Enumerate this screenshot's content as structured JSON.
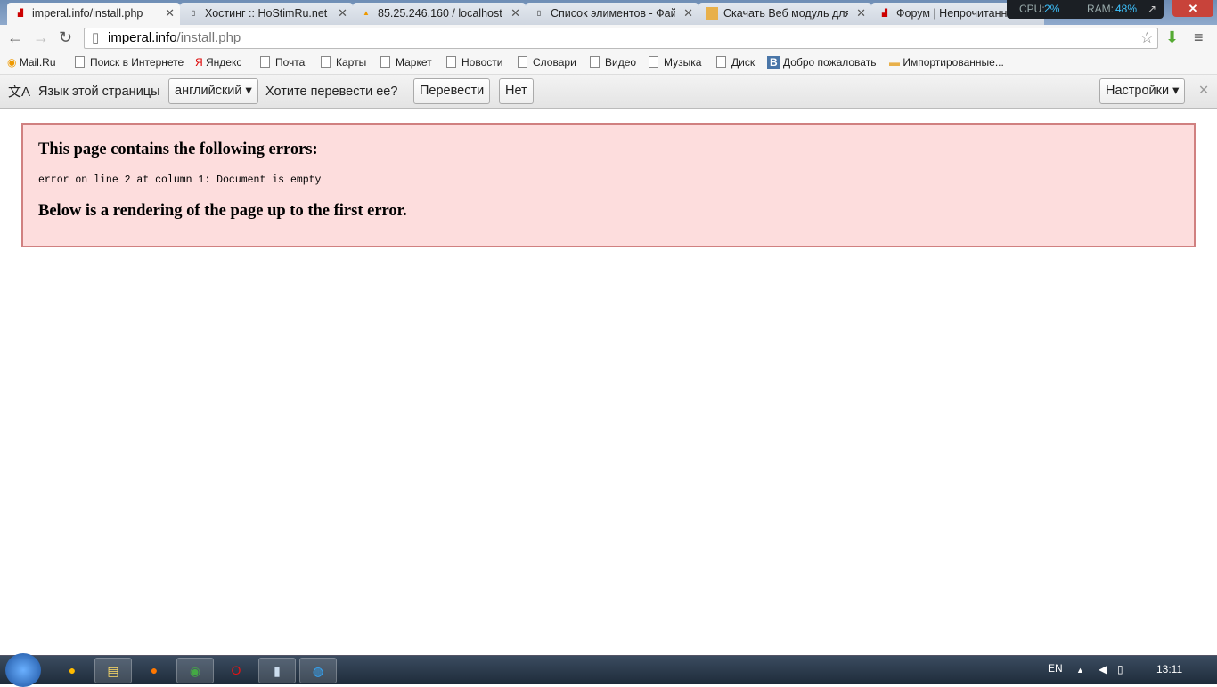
{
  "tabs": [
    {
      "title": "imperal.info/install.php",
      "icon": "cms-icon",
      "active": true
    },
    {
      "title": "Хостинг :: HoStimRu.net",
      "icon": "page-icon"
    },
    {
      "title": "85.25.246.160 / localhost /",
      "icon": "phpmyadmin-icon"
    },
    {
      "title": "Список элиментов - Фай",
      "icon": "page-icon"
    },
    {
      "title": "Скачать Веб модуль для",
      "icon": "folder-icon"
    },
    {
      "title": "Форум | Непрочитанн",
      "icon": "cms-icon"
    }
  ],
  "sysmon": {
    "cpu_label": "CPU:",
    "cpu": "2%",
    "ram_label": "RAM:",
    "ram": "48%"
  },
  "address": {
    "host": "imperal.info",
    "path": "/install.php"
  },
  "bookmarks": [
    "Mail.Ru",
    "Поиск в Интернете",
    "Яндекс",
    "Почта",
    "Карты",
    "Маркет",
    "Новости",
    "Словари",
    "Видео",
    "Музыка",
    "Диск",
    "Добро пожаловать",
    "Импортированные..."
  ],
  "translate": {
    "label": "Язык этой страницы",
    "language": "английский",
    "question": "Хотите перевести ее?",
    "translate_btn": "Перевести",
    "no_btn": "Нет",
    "settings_btn": "Настройки"
  },
  "error": {
    "heading": "This page contains the following errors:",
    "message": "error on line 2 at column 1: Document is empty",
    "footer": "Below is a rendering of the page up to the first error."
  },
  "tray": {
    "lang": "EN",
    "clock": "13:11"
  },
  "colors": {
    "error_bg": "#fddddd",
    "error_border": "#d08080"
  }
}
